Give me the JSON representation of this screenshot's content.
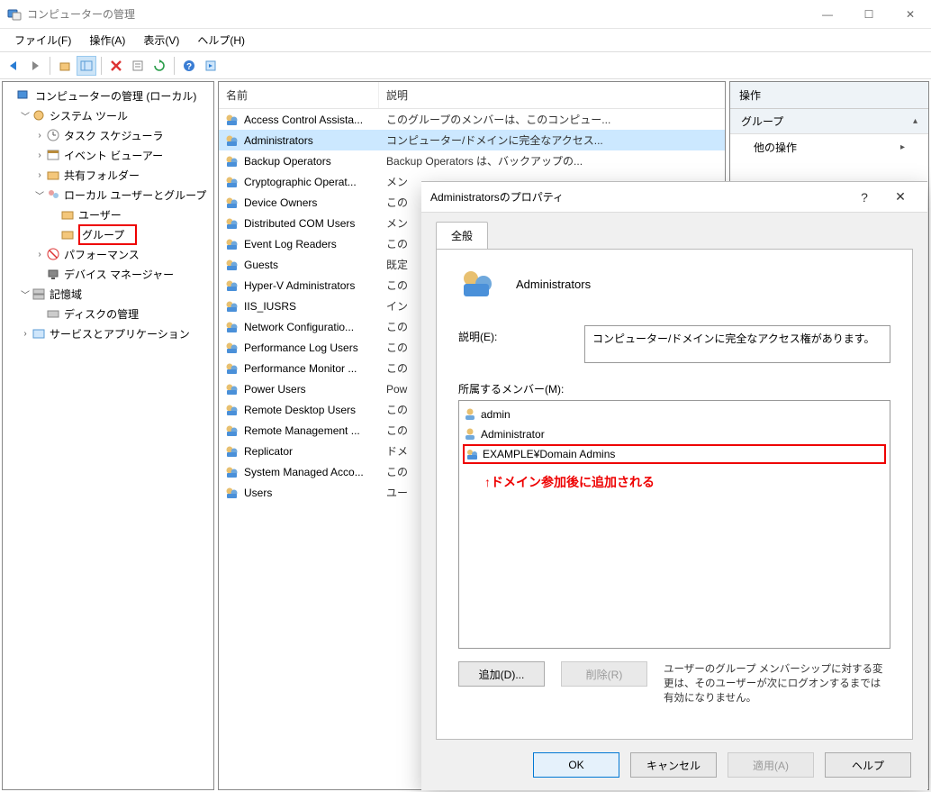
{
  "window": {
    "title": "コンピューターの管理"
  },
  "menubar": [
    "ファイル(F)",
    "操作(A)",
    "表示(V)",
    "ヘルプ(H)"
  ],
  "tree": {
    "root": "コンピューターの管理 (ローカル)",
    "system_tools": "システム ツール",
    "task_scheduler": "タスク スケジューラ",
    "event_viewer": "イベント ビューアー",
    "shared_folders": "共有フォルダー",
    "local_users": "ローカル ユーザーとグループ",
    "users": "ユーザー",
    "groups": "グループ",
    "performance": "パフォーマンス",
    "device_mgr": "デバイス マネージャー",
    "storage": "記憶域",
    "disk_mgmt": "ディスクの管理",
    "services": "サービスとアプリケーション"
  },
  "list": {
    "col_name": "名前",
    "col_desc": "説明",
    "rows": [
      {
        "name": "Access Control Assista...",
        "desc": "このグループのメンバーは、このコンピュー..."
      },
      {
        "name": "Administrators",
        "desc": "コンピューター/ドメインに完全なアクセス...",
        "selected": true
      },
      {
        "name": "Backup Operators",
        "desc": "Backup Operators は、バックアップの..."
      },
      {
        "name": "Cryptographic Operat...",
        "desc": "メン"
      },
      {
        "name": "Device Owners",
        "desc": "この"
      },
      {
        "name": "Distributed COM Users",
        "desc": "メン"
      },
      {
        "name": "Event Log Readers",
        "desc": "この"
      },
      {
        "name": "Guests",
        "desc": "既定"
      },
      {
        "name": "Hyper-V Administrators",
        "desc": "この"
      },
      {
        "name": "IIS_IUSRS",
        "desc": "イン"
      },
      {
        "name": "Network Configuratio...",
        "desc": "この"
      },
      {
        "name": "Performance Log Users",
        "desc": "この"
      },
      {
        "name": "Performance Monitor ...",
        "desc": "この"
      },
      {
        "name": "Power Users",
        "desc": "Pow"
      },
      {
        "name": "Remote Desktop Users",
        "desc": "この"
      },
      {
        "name": "Remote Management ...",
        "desc": "この"
      },
      {
        "name": "Replicator",
        "desc": "ドメ"
      },
      {
        "name": "System Managed Acco...",
        "desc": "この"
      },
      {
        "name": "Users",
        "desc": "ユー"
      }
    ]
  },
  "actions": {
    "header": "操作",
    "group_head": "グループ",
    "other_ops": "他の操作"
  },
  "dialog": {
    "title": "Administratorsのプロパティ",
    "tab_general": "全般",
    "group_name": "Administrators",
    "desc_label": "説明(E):",
    "desc_value": "コンピューター/ドメインに完全なアクセス権があります。",
    "members_label": "所属するメンバー(M):",
    "members": [
      {
        "name": "admin",
        "type": "user"
      },
      {
        "name": "Administrator",
        "type": "user"
      },
      {
        "name": "EXAMPLE¥Domain Admins",
        "type": "group",
        "highlight": true
      }
    ],
    "annotation": "↑ドメイン参加後に追加される",
    "add_btn": "追加(D)...",
    "remove_btn": "削除(R)",
    "note": "ユーザーのグループ メンバーシップに対する変更は、そのユーザーが次にログオンするまでは有効になりません。",
    "ok": "OK",
    "cancel": "キャンセル",
    "apply": "適用(A)",
    "help": "ヘルプ"
  }
}
